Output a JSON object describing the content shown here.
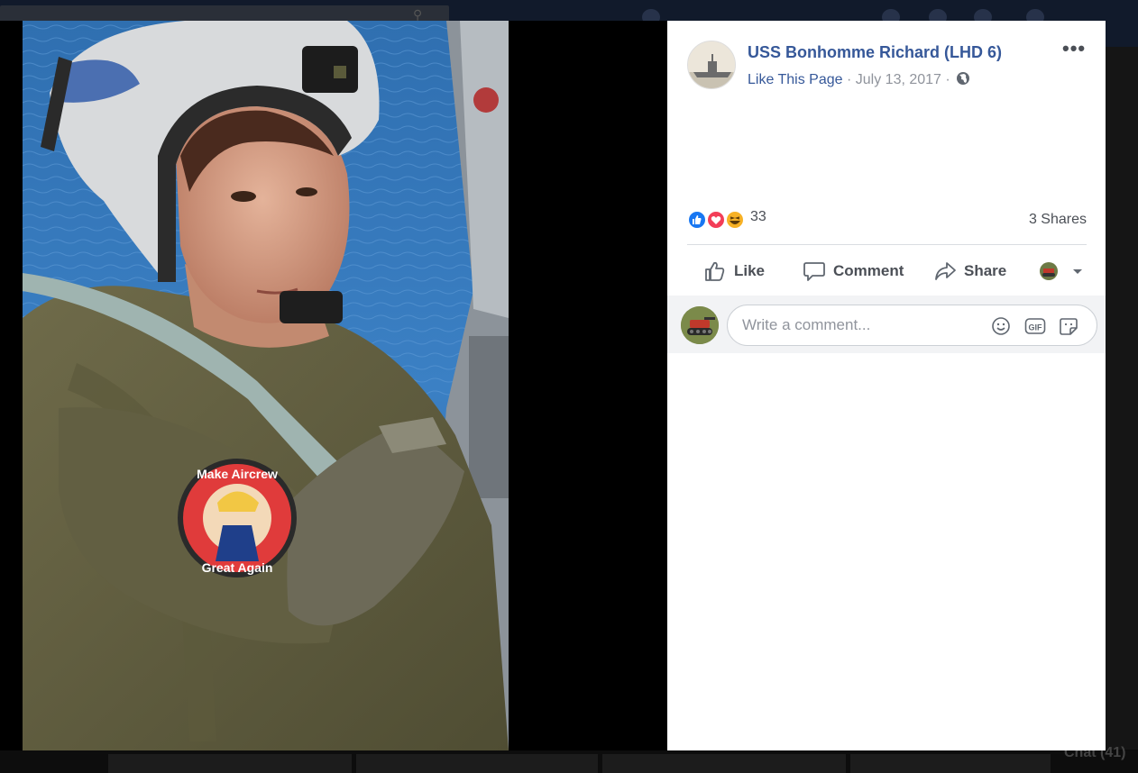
{
  "post": {
    "page_name": "USS Bonhomme Richard (LHD 6)",
    "like_page_label": "Like This Page",
    "separator": " · ",
    "date": "July 13, 2017",
    "audience_icon": "globe-icon",
    "more_icon": "more-options-icon",
    "more_label": "•••"
  },
  "photo": {
    "description_icon": "aviator-photo",
    "patch_line1": "Make Aircrew",
    "patch_line2": "Great Again"
  },
  "stats": {
    "reaction_icons": [
      "like-reaction-icon",
      "love-reaction-icon",
      "haha-reaction-icon"
    ],
    "reaction_count": "33",
    "shares_label": "3 Shares"
  },
  "actions": {
    "like_label": "Like",
    "comment_label": "Comment",
    "share_label": "Share"
  },
  "comment": {
    "placeholder": "Write a comment..."
  },
  "chrome": {
    "chat_label": "Chat (41)"
  },
  "colors": {
    "link_blue": "#365899",
    "meta_gray": "#90949c",
    "like_blue": "#1877f2",
    "love_red": "#f33e58",
    "haha_yellow": "#f7b125"
  }
}
